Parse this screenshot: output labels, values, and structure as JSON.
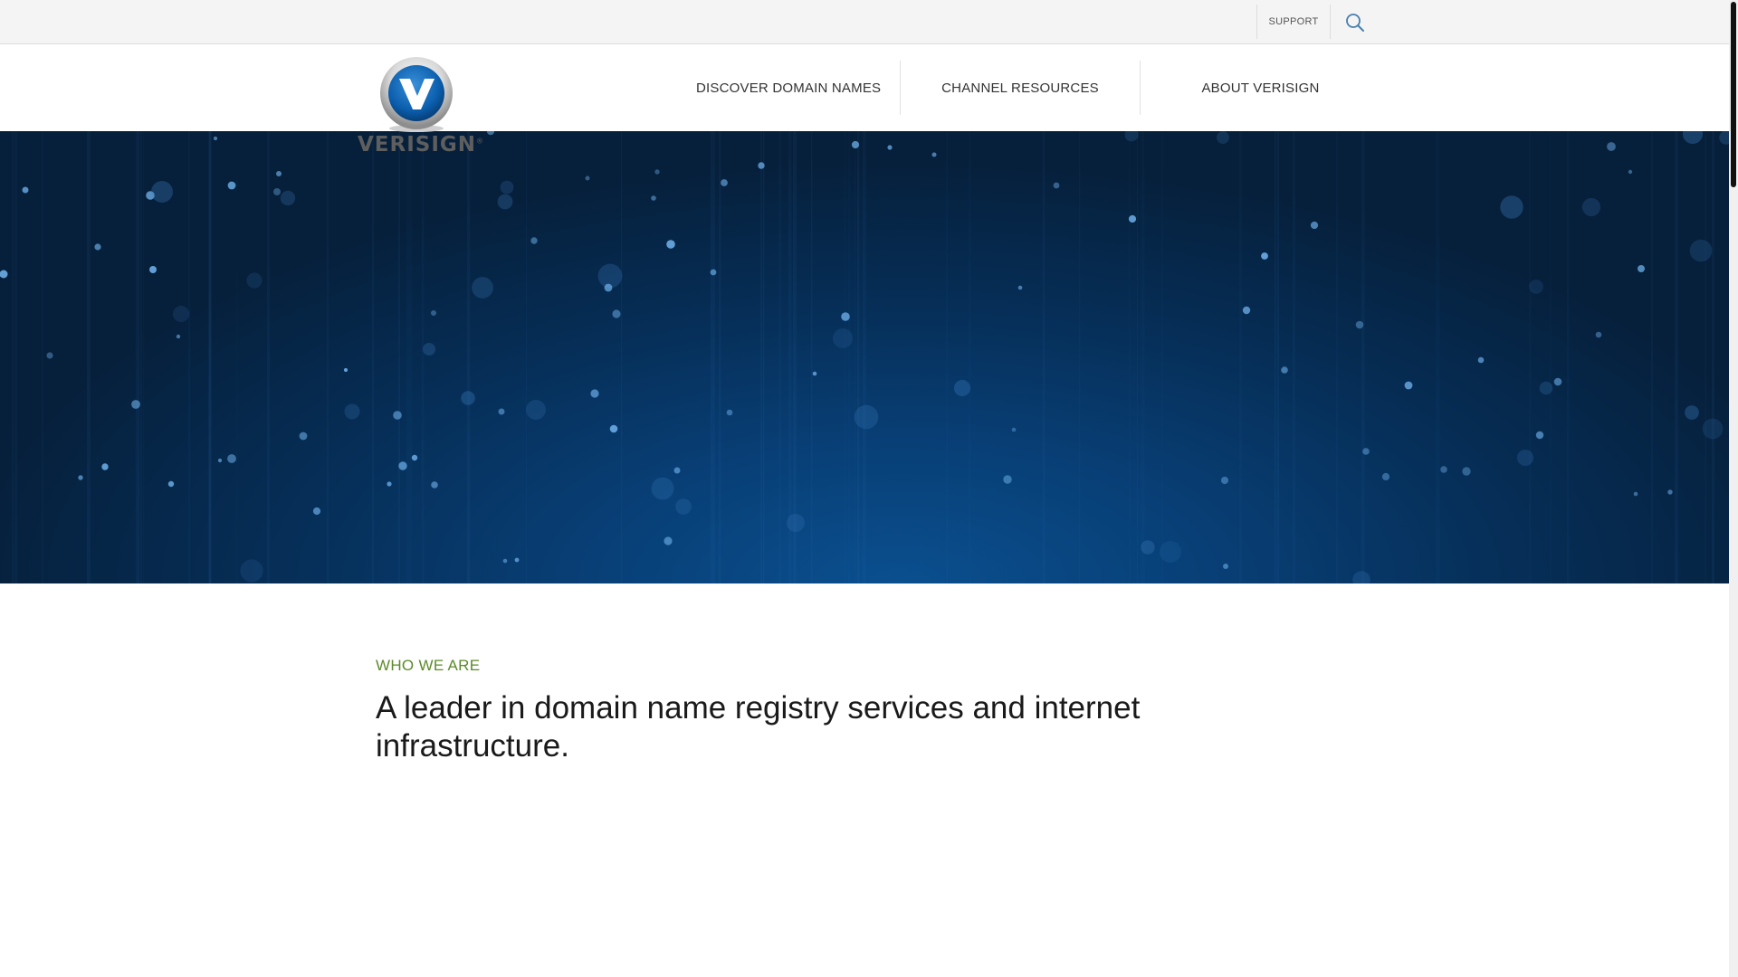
{
  "utility": {
    "support_label": "SUPPORT",
    "search_icon": "search-icon"
  },
  "logo": {
    "wordmark": "VERISIGN",
    "emblem_letter": "V",
    "trademark": "®"
  },
  "nav": {
    "items": [
      {
        "label": "DISCOVER DOMAIN NAMES"
      },
      {
        "label": "CHANNEL RESOURCES"
      },
      {
        "label": "ABOUT VERISIGN"
      }
    ]
  },
  "content": {
    "eyebrow": "WHO WE ARE",
    "headline": "A leader in domain name registry services and internet infrastructure."
  },
  "colors": {
    "accent_green": "#5b8a2a",
    "logo_blue": "#0b5fae",
    "hero_blue": "#083e74"
  }
}
